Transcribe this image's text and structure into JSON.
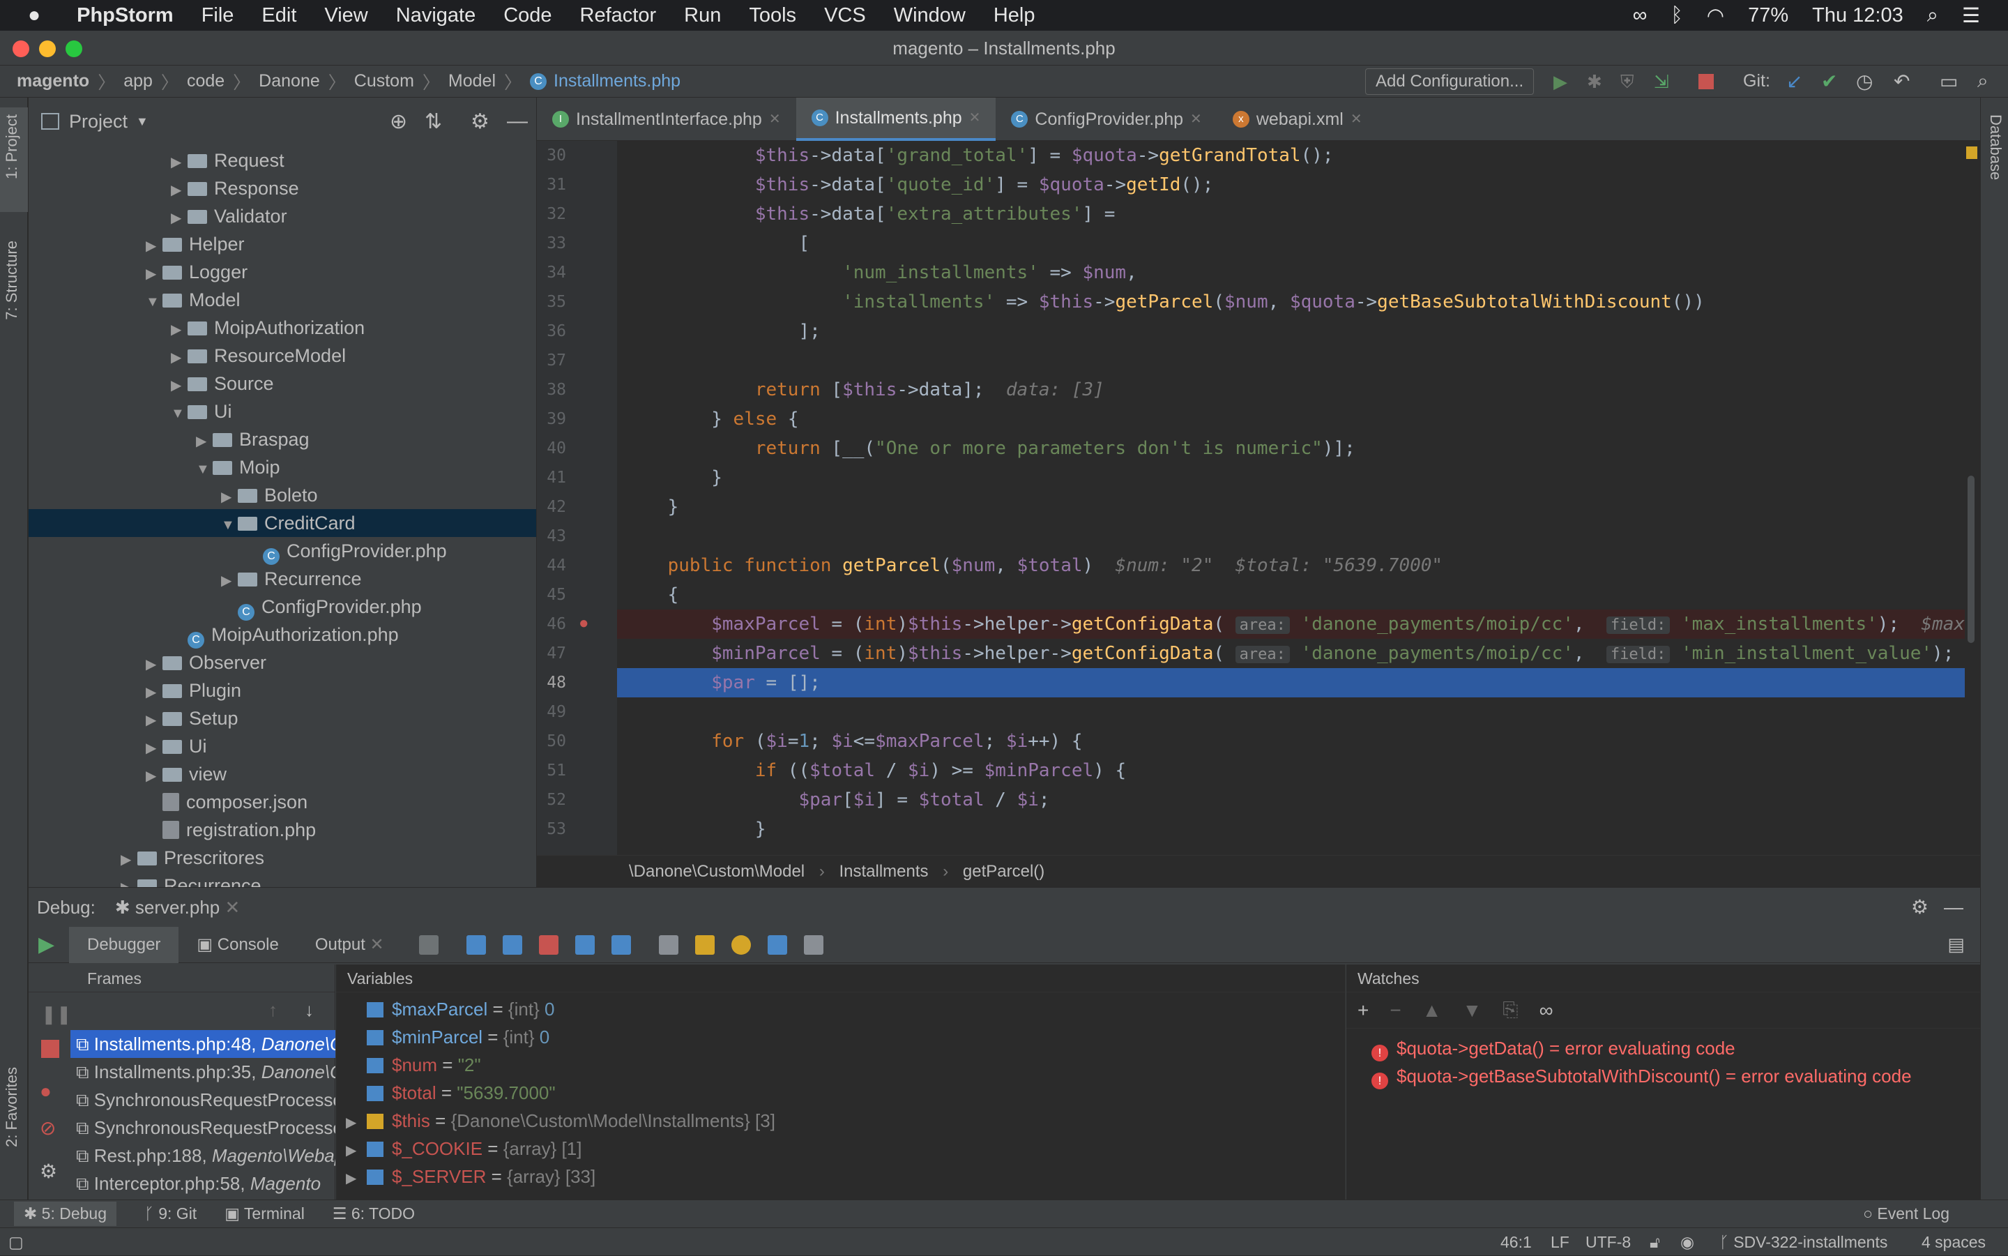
{
  "menubar": {
    "app": "PhpStorm",
    "items": [
      "File",
      "Edit",
      "View",
      "Navigate",
      "Code",
      "Refactor",
      "Run",
      "Tools",
      "VCS",
      "Window",
      "Help"
    ],
    "battery": "77%",
    "clock": "Thu 12:03"
  },
  "window": {
    "title": "magento – Installments.php"
  },
  "nav": {
    "breadcrumb": [
      "magento",
      "app",
      "code",
      "Danone",
      "Custom",
      "Model",
      "Installments.php"
    ],
    "add_config": "Add Configuration...",
    "git_label": "Git:"
  },
  "sidebar_tabs": {
    "project": "1: Project",
    "structure": "7: Structure",
    "favorites": "2: Favorites",
    "database": "Database"
  },
  "project": {
    "title": "Project",
    "tree": [
      {
        "label": "Request",
        "indent": 5,
        "type": "folder",
        "arrow": "▶"
      },
      {
        "label": "Response",
        "indent": 5,
        "type": "folder",
        "arrow": "▶"
      },
      {
        "label": "Validator",
        "indent": 5,
        "type": "folder",
        "arrow": "▶"
      },
      {
        "label": "Helper",
        "indent": 4,
        "type": "folder",
        "arrow": "▶"
      },
      {
        "label": "Logger",
        "indent": 4,
        "type": "folder",
        "arrow": "▶"
      },
      {
        "label": "Model",
        "indent": 4,
        "type": "folder",
        "arrow": "▼"
      },
      {
        "label": "MoipAuthorization",
        "indent": 5,
        "type": "folder",
        "arrow": "▶"
      },
      {
        "label": "ResourceModel",
        "indent": 5,
        "type": "folder",
        "arrow": "▶"
      },
      {
        "label": "Source",
        "indent": 5,
        "type": "folder",
        "arrow": "▶"
      },
      {
        "label": "Ui",
        "indent": 5,
        "type": "folder",
        "arrow": "▼"
      },
      {
        "label": "Braspag",
        "indent": 6,
        "type": "folder",
        "arrow": "▶"
      },
      {
        "label": "Moip",
        "indent": 6,
        "type": "folder",
        "arrow": "▼"
      },
      {
        "label": "Boleto",
        "indent": 7,
        "type": "folder",
        "arrow": "▶"
      },
      {
        "label": "CreditCard",
        "indent": 7,
        "type": "folder",
        "arrow": "▼",
        "selected": true
      },
      {
        "label": "ConfigProvider.php",
        "indent": 8,
        "type": "class",
        "arrow": ""
      },
      {
        "label": "Recurrence",
        "indent": 7,
        "type": "folder",
        "arrow": "▶"
      },
      {
        "label": "ConfigProvider.php",
        "indent": 7,
        "type": "class",
        "arrow": ""
      },
      {
        "label": "MoipAuthorization.php",
        "indent": 5,
        "type": "class",
        "arrow": ""
      },
      {
        "label": "Observer",
        "indent": 4,
        "type": "folder",
        "arrow": "▶"
      },
      {
        "label": "Plugin",
        "indent": 4,
        "type": "folder",
        "arrow": "▶"
      },
      {
        "label": "Setup",
        "indent": 4,
        "type": "folder",
        "arrow": "▶"
      },
      {
        "label": "Ui",
        "indent": 4,
        "type": "folder",
        "arrow": "▶"
      },
      {
        "label": "view",
        "indent": 4,
        "type": "folder",
        "arrow": "▶"
      },
      {
        "label": "composer.json",
        "indent": 4,
        "type": "file",
        "arrow": ""
      },
      {
        "label": "registration.php",
        "indent": 4,
        "type": "file",
        "arrow": ""
      },
      {
        "label": "Prescritores",
        "indent": 3,
        "type": "folder",
        "arrow": "▶"
      },
      {
        "label": "Recurrence",
        "indent": 3,
        "type": "folder",
        "arrow": "▶"
      }
    ]
  },
  "tabs": [
    {
      "label": "InstallmentInterface.php",
      "icon": "I",
      "color": "#59a869",
      "active": false
    },
    {
      "label": "Installments.php",
      "icon": "C",
      "color": "#4a8fc2",
      "active": true
    },
    {
      "label": "ConfigProvider.php",
      "icon": "C",
      "color": "#4a8fc2",
      "active": false
    },
    {
      "label": "webapi.xml",
      "icon": "x",
      "color": "#cc7832",
      "active": false
    }
  ],
  "code_lines": [
    {
      "n": "30",
      "html": "            <span class='v'>$this</span>-&gt;data[<span class='s'>'grand_total'</span>] = <span class='v'>$quota</span>-&gt;<span class='f'>getGrandTotal</span>();"
    },
    {
      "n": "31",
      "html": "            <span class='v'>$this</span>-&gt;data[<span class='s'>'quote_id'</span>] = <span class='v'>$quota</span>-&gt;<span class='f'>getId</span>();"
    },
    {
      "n": "32",
      "html": "            <span class='v'>$this</span>-&gt;data[<span class='s'>'extra_attributes'</span>] ="
    },
    {
      "n": "33",
      "html": "                ["
    },
    {
      "n": "34",
      "html": "                    <span class='s'>'num_installments'</span> =&gt; <span class='v'>$num</span>,"
    },
    {
      "n": "35",
      "html": "                    <span class='s'>'installments'</span> =&gt; <span class='v'>$this</span>-&gt;<span class='f'>getParcel</span>(<span class='v'>$num</span>, <span class='v'>$quota</span>-&gt;<span class='f'>getBaseSubtotalWithDiscount</span>())"
    },
    {
      "n": "36",
      "html": "                ];"
    },
    {
      "n": "37",
      "html": ""
    },
    {
      "n": "38",
      "html": "            <span class='k'>return</span> [<span class='v'>$this</span>-&gt;data];  <span class='hint'>data: [3]</span>"
    },
    {
      "n": "39",
      "html": "        } <span class='k'>else</span> {"
    },
    {
      "n": "40",
      "html": "            <span class='k'>return</span> [__(<span class='s'>\"One or more parameters don't is numeric\"</span>)];"
    },
    {
      "n": "41",
      "html": "        }"
    },
    {
      "n": "42",
      "html": "    }"
    },
    {
      "n": "43",
      "html": ""
    },
    {
      "n": "44",
      "html": "    <span class='k'>public function</span> <span class='f'>getParcel</span>(<span class='v'>$num</span>, <span class='v'>$total</span>)  <span class='hint'>$num: \"2\"  $total: \"5639.7000\"</span>"
    },
    {
      "n": "45",
      "html": "    {"
    },
    {
      "n": "46",
      "html": "        <span class='v'>$maxParcel</span> = (<span class='k'>int</span>)<span class='v'>$this</span>-&gt;helper-&gt;<span class='f'>getConfigData</span>( <span class='pill'>area:</span> <span class='s'>'danone_payments/moip/cc'</span>,  <span class='pill'>field:</span> <span class='s'>'max_installments'</span>);  <span class='hint'>$maxPa</span>",
      "style": "red"
    },
    {
      "n": "47",
      "html": "        <span class='v'>$minParcel</span> = (<span class='k'>int</span>)<span class='v'>$this</span>-&gt;helper-&gt;<span class='f'>getConfigData</span>( <span class='pill'>area:</span> <span class='s'>'danone_payments/moip/cc'</span>,  <span class='pill'>field:</span> <span class='s'>'min_installment_value'</span>); <span class='hint'>$</span>"
    },
    {
      "n": "48",
      "html": "        <span class='v'>$par</span> = [];",
      "style": "blue"
    },
    {
      "n": "49",
      "html": ""
    },
    {
      "n": "50",
      "html": "        <span class='k'>for</span> (<span class='v'>$i</span>=<span class='vnum'>1</span>; <span class='v'>$i</span>&lt;=<span class='v'>$maxParcel</span>; <span class='v'>$i</span>++) {"
    },
    {
      "n": "51",
      "html": "            <span class='k'>if</span> ((<span class='v'>$total</span> / <span class='v'>$i</span>) &gt;= <span class='v'>$minParcel</span>) {"
    },
    {
      "n": "52",
      "html": "                <span class='v'>$par</span>[<span class='v'>$i</span>] = <span class='v'>$total</span> / <span class='v'>$i</span>;"
    },
    {
      "n": "53",
      "html": "            }"
    }
  ],
  "editor_breadcrumb": [
    "\\Danone\\Custom\\Model",
    "Installments",
    "getParcel()"
  ],
  "debug": {
    "label": "Debug:",
    "session": "server.php",
    "tabs": [
      "Debugger",
      "Console",
      "Output"
    ],
    "frames_title": "Frames",
    "variables_title": "Variables",
    "watches_title": "Watches",
    "frames": [
      {
        "file": "Installments.php:48,",
        "ns": " Danone\\Custom\\Model\\Installments",
        "sel": true
      },
      {
        "file": "Installments.php:35,",
        "ns": " Danone\\Custom\\Model",
        "sel": false
      },
      {
        "file": "SynchronousRequestProcessor",
        "ns": "",
        "sel": false
      },
      {
        "file": "SynchronousRequestProcessor",
        "ns": "",
        "sel": false
      },
      {
        "file": "Rest.php:188,",
        "ns": " Magento\\Webapi",
        "sel": false
      },
      {
        "file": "Interceptor.php:58,",
        "ns": " Magento",
        "sel": false
      }
    ],
    "variables": [
      {
        "name": "$maxParcel",
        "eq": " = ",
        "type": "{int} ",
        "val": "0",
        "kind": "num",
        "expand": false,
        "nameblue": true
      },
      {
        "name": "$minParcel",
        "eq": " = ",
        "type": "{int} ",
        "val": "0",
        "kind": "num",
        "expand": false,
        "nameblue": true
      },
      {
        "name": "$num",
        "eq": " = ",
        "type": "",
        "val": "\"2\"",
        "kind": "str",
        "expand": false,
        "nameblue": false
      },
      {
        "name": "$total",
        "eq": " = ",
        "type": "",
        "val": "\"5639.7000\"",
        "kind": "str",
        "expand": false,
        "nameblue": false
      },
      {
        "name": "$this",
        "eq": " = ",
        "type": "{Danone\\Custom\\Model\\Installments} [3]",
        "val": "",
        "kind": "obj",
        "expand": true,
        "nameblue": false
      },
      {
        "name": "$_COOKIE",
        "eq": " = ",
        "type": "{array} [1]",
        "val": "",
        "kind": "arr",
        "expand": true,
        "nameblue": false
      },
      {
        "name": "$_SERVER",
        "eq": " = ",
        "type": "{array} [33]",
        "val": "",
        "kind": "arr",
        "expand": true,
        "nameblue": false
      }
    ],
    "watches": [
      "$quota->getData() = error evaluating code",
      "$quota->getBaseSubtotalWithDiscount() = error evaluating code"
    ]
  },
  "toolwindows": [
    "5: Debug",
    "9: Git",
    "Terminal",
    "6: TODO"
  ],
  "event_log": "Event Log",
  "status": {
    "pos": "46:1",
    "le": "LF",
    "enc": "UTF-8",
    "branch": "SDV-322-installments",
    "indent": "4 spaces"
  }
}
